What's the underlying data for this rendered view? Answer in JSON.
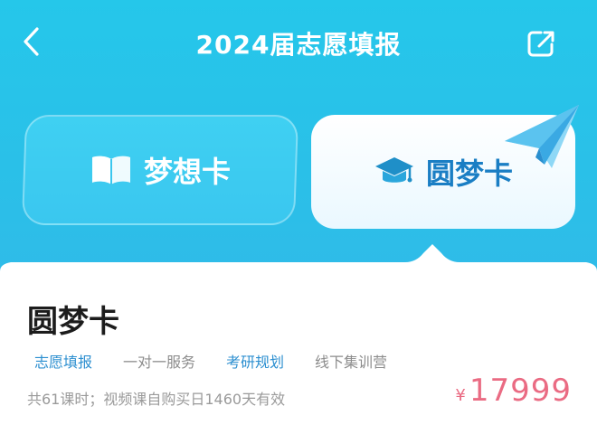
{
  "header": {
    "title": "2024届志愿填报",
    "back_icon": "chevron-left-icon",
    "share_icon": "share-icon"
  },
  "tabs": [
    {
      "label": "梦想卡",
      "icon": "open-book-icon",
      "selected": false
    },
    {
      "label": "圆梦卡",
      "icon": "graduation-cap-icon",
      "selected": true
    }
  ],
  "decoration": {
    "icon": "paper-plane-icon"
  },
  "card": {
    "title": "圆梦卡",
    "tags": [
      "志愿填报",
      "一对一服务",
      "考研规划",
      "线下集训营"
    ],
    "description": "共61课时；视频课自购买日1460天有效",
    "price": {
      "currency": "¥",
      "value": "17999"
    }
  },
  "colors": {
    "background": "#2bbfe8",
    "accent_blue": "#2c8fd0",
    "price_pink": "#ea6b83",
    "white": "#ffffff"
  }
}
